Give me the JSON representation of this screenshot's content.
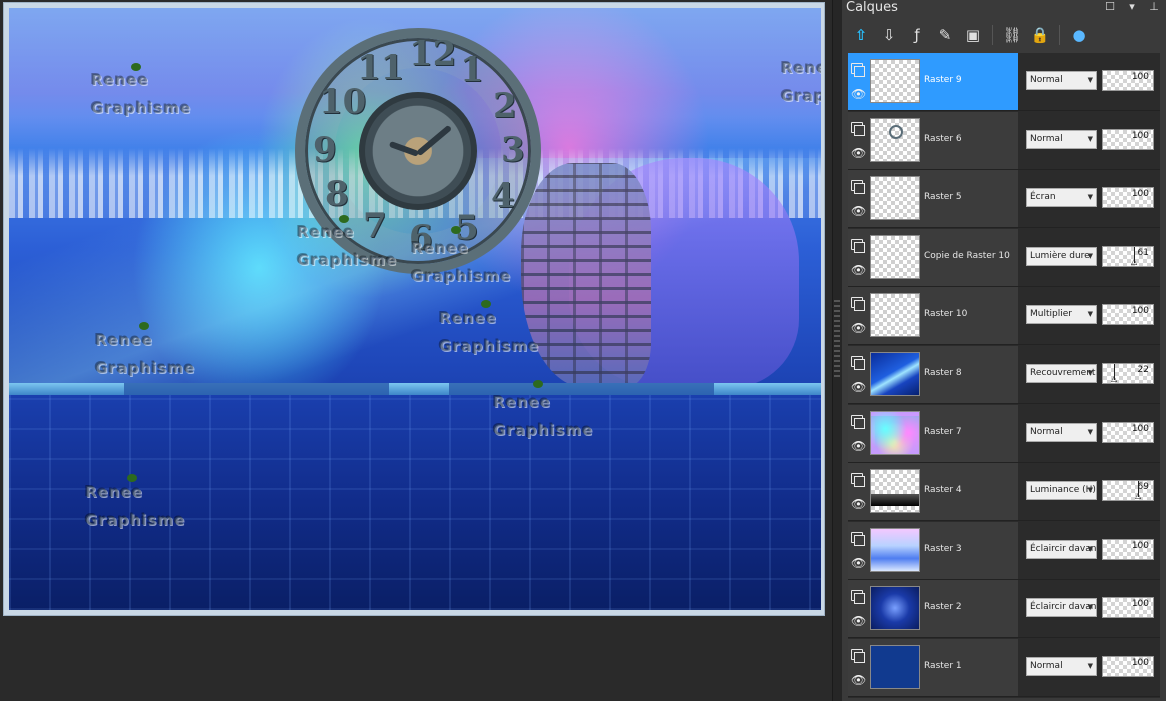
{
  "panel": {
    "title": "Calques",
    "buttons": [
      "maximize",
      "dropdown",
      "pin"
    ]
  },
  "toolbar": {
    "tools": [
      {
        "name": "new-raster-layer-icon"
      },
      {
        "name": "merge-down-icon"
      },
      {
        "name": "layer-style-icon"
      },
      {
        "name": "edit-selection-icon"
      },
      {
        "name": "mask-icon"
      },
      {
        "name": "link-icon"
      },
      {
        "name": "lock-icon"
      },
      {
        "name": "highlight-icon"
      }
    ]
  },
  "layers": [
    {
      "name": "Raster 9",
      "blend": "Normal",
      "opacity": "100",
      "selected": true,
      "thumb": "transparent"
    },
    {
      "name": "Raster 6",
      "blend": "Normal",
      "opacity": "100",
      "selected": false,
      "thumb": "transparent-clock"
    },
    {
      "name": "Raster 5",
      "blend": "Écran",
      "opacity": "100",
      "selected": false,
      "thumb": "transparent"
    },
    {
      "name": "Copie de Raster 10",
      "blend": "Lumière dure",
      "opacity": "61",
      "selected": false,
      "thumb": "transparent"
    },
    {
      "name": "Raster 10",
      "blend": "Multiplier",
      "opacity": "100",
      "selected": false,
      "thumb": "transparent"
    },
    {
      "name": "Raster 8",
      "blend": "Recouvrement",
      "opacity": "22",
      "selected": false,
      "thumb": "blue-beam"
    },
    {
      "name": "Raster 7",
      "blend": "Normal",
      "opacity": "100",
      "selected": false,
      "thumb": "rainbow"
    },
    {
      "name": "Raster 4",
      "blend": "Luminance (H)",
      "opacity": "69",
      "selected": false,
      "thumb": "dark-strip"
    },
    {
      "name": "Raster 3",
      "blend": "Éclaircir davantage",
      "opacity": "100",
      "selected": false,
      "thumb": "sky"
    },
    {
      "name": "Raster 2",
      "blend": "Éclaircir davantage",
      "opacity": "100",
      "selected": false,
      "thumb": "blue-burst"
    },
    {
      "name": "Raster 1",
      "blend": "Normal",
      "opacity": "100",
      "selected": false,
      "thumb": "solid-blue"
    }
  ],
  "canvas": {
    "watermark_line1": "Renee",
    "watermark_line2": "Graphisme",
    "clock_numbers": [
      "12",
      "1",
      "2",
      "3",
      "4",
      "5",
      "6",
      "7",
      "8",
      "9",
      "10",
      "11"
    ]
  },
  "colors": {
    "selected_row": "#2f9bff",
    "panel_bg": "#3a3a3a",
    "row_bg": "#3c3c3c"
  }
}
